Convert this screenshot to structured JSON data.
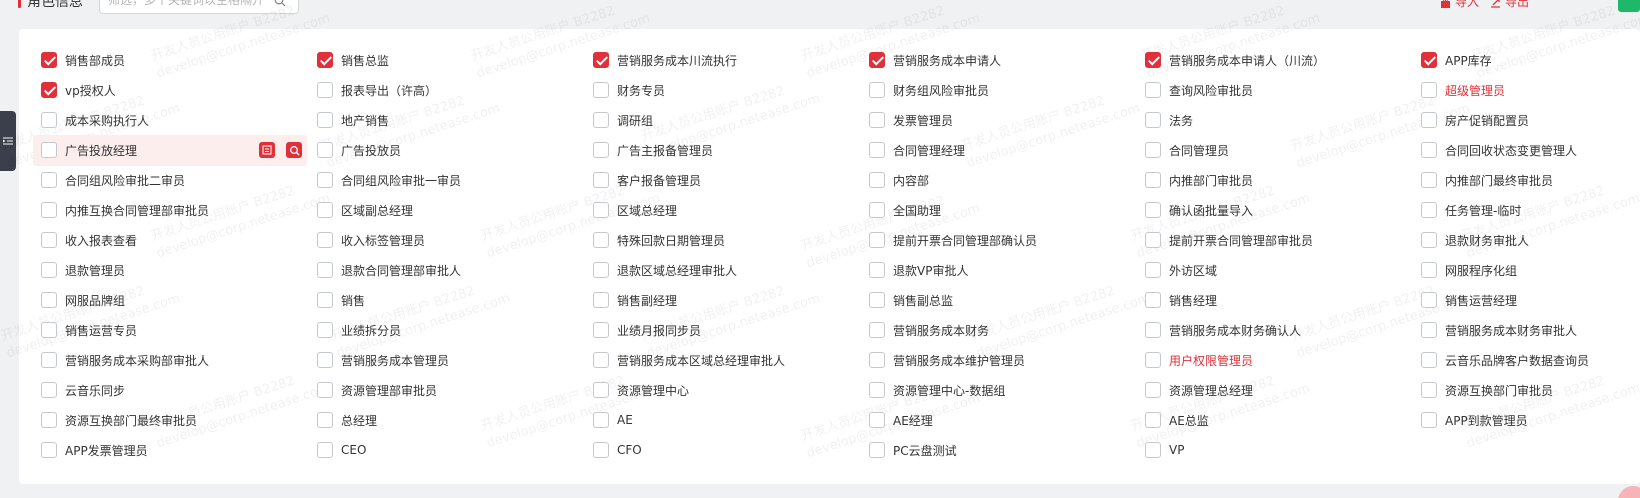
{
  "header": {
    "title": "角色信息",
    "search_placeholder": "筛选，多个关键词以空格隔开",
    "import_label": "导入",
    "export_label": "导出"
  },
  "watermark": {
    "line1": "开发人员公用账户 B2282",
    "line2": "develop@corp.netease.com"
  },
  "colors": {
    "accent": "#e0313a",
    "checked": "#e0313a",
    "green_button": "#1fb86a",
    "sidebar_tab": "#3a3f4b"
  },
  "roles": [
    [
      {
        "label": "销售部成员",
        "checked": true
      },
      {
        "label": "vp授权人",
        "checked": true
      },
      {
        "label": "成本采购执行人",
        "checked": false
      },
      {
        "label": "广告投放经理",
        "checked": false
      },
      {
        "label": "合同组风险审批二审员",
        "checked": false
      },
      {
        "label": "内推互换合同管理部审批员",
        "checked": false
      },
      {
        "label": "收入报表查看",
        "checked": false
      },
      {
        "label": "退款管理员",
        "checked": false
      },
      {
        "label": "网服品牌组",
        "checked": false
      },
      {
        "label": "销售运营专员",
        "checked": false
      },
      {
        "label": "营销服务成本采购部审批人",
        "checked": false
      },
      {
        "label": "云音乐同步",
        "checked": false
      },
      {
        "label": "资源互换部门最终审批员",
        "checked": false
      },
      {
        "label": "APP发票管理员",
        "checked": false
      }
    ],
    [
      {
        "label": "销售总监",
        "checked": true
      },
      {
        "label": "报表导出（许高）",
        "checked": false
      },
      {
        "label": "地产销售",
        "checked": false
      },
      {
        "label": "广告投放员",
        "checked": false
      },
      {
        "label": "合同组风险审批一审员",
        "checked": false
      },
      {
        "label": "区域副总经理",
        "checked": false
      },
      {
        "label": "收入标签管理员",
        "checked": false
      },
      {
        "label": "退款合同管理部审批人",
        "checked": false
      },
      {
        "label": "销售",
        "checked": false
      },
      {
        "label": "业绩拆分员",
        "checked": false
      },
      {
        "label": "营销服务成本管理员",
        "checked": false
      },
      {
        "label": "资源管理部审批员",
        "checked": false
      },
      {
        "label": "总经理",
        "checked": false
      },
      {
        "label": "CEO",
        "checked": false
      }
    ],
    [
      {
        "label": "营销服务成本川流执行",
        "checked": true
      },
      {
        "label": "财务专员",
        "checked": false
      },
      {
        "label": "调研组",
        "checked": false
      },
      {
        "label": "广告主报备管理员",
        "checked": false
      },
      {
        "label": "客户报备管理员",
        "checked": false
      },
      {
        "label": "区域总经理",
        "checked": false
      },
      {
        "label": "特殊回款日期管理员",
        "checked": false
      },
      {
        "label": "退款区域总经理审批人",
        "checked": false
      },
      {
        "label": "销售副经理",
        "checked": false
      },
      {
        "label": "业绩月报同步员",
        "checked": false
      },
      {
        "label": "营销服务成本区域总经理审批人",
        "checked": false
      },
      {
        "label": "资源管理中心",
        "checked": false
      },
      {
        "label": "AE",
        "checked": false
      },
      {
        "label": "CFO",
        "checked": false
      }
    ],
    [
      {
        "label": "营销服务成本申请人",
        "checked": true
      },
      {
        "label": "财务组风险审批员",
        "checked": false
      },
      {
        "label": "发票管理员",
        "checked": false
      },
      {
        "label": "合同管理经理",
        "checked": false
      },
      {
        "label": "内容部",
        "checked": false
      },
      {
        "label": "全国助理",
        "checked": false
      },
      {
        "label": "提前开票合同管理部确认员",
        "checked": false
      },
      {
        "label": "退款VP审批人",
        "checked": false
      },
      {
        "label": "销售副总监",
        "checked": false
      },
      {
        "label": "营销服务成本财务",
        "checked": false
      },
      {
        "label": "营销服务成本维护管理员",
        "checked": false
      },
      {
        "label": "资源管理中心-数据组",
        "checked": false
      },
      {
        "label": "AE经理",
        "checked": false
      },
      {
        "label": "PC云盘测试",
        "checked": false
      }
    ],
    [
      {
        "label": "营销服务成本申请人（川流）",
        "checked": true
      },
      {
        "label": "查询风险审批员",
        "checked": false
      },
      {
        "label": "法务",
        "checked": false
      },
      {
        "label": "合同管理员",
        "checked": false
      },
      {
        "label": "内推部门审批员",
        "checked": false
      },
      {
        "label": "确认函批量导入",
        "checked": false
      },
      {
        "label": "提前开票合同管理部审批员",
        "checked": false
      },
      {
        "label": "外访区域",
        "checked": false
      },
      {
        "label": "销售经理",
        "checked": false
      },
      {
        "label": "营销服务成本财务确认人",
        "checked": false
      },
      {
        "label": "用户权限管理员",
        "checked": false,
        "red": true
      },
      {
        "label": "资源管理总经理",
        "checked": false
      },
      {
        "label": "AE总监",
        "checked": false
      },
      {
        "label": "VP",
        "checked": false
      }
    ],
    [
      {
        "label": "APP库存",
        "checked": true
      },
      {
        "label": "超级管理员",
        "checked": false,
        "red": true
      },
      {
        "label": "房产促销配置员",
        "checked": false
      },
      {
        "label": "合同回收状态变更管理人",
        "checked": false
      },
      {
        "label": "内推部门最终审批员",
        "checked": false
      },
      {
        "label": "任务管理-临时",
        "checked": false
      },
      {
        "label": "退款财务审批人",
        "checked": false
      },
      {
        "label": "网服程序化组",
        "checked": false
      },
      {
        "label": "销售运营经理",
        "checked": false
      },
      {
        "label": "营销服务成本财务审批人",
        "checked": false
      },
      {
        "label": "云音乐品牌客户数据查询员",
        "checked": false
      },
      {
        "label": "资源互换部门审批员",
        "checked": false
      },
      {
        "label": "APP到款管理员",
        "checked": false
      }
    ]
  ]
}
